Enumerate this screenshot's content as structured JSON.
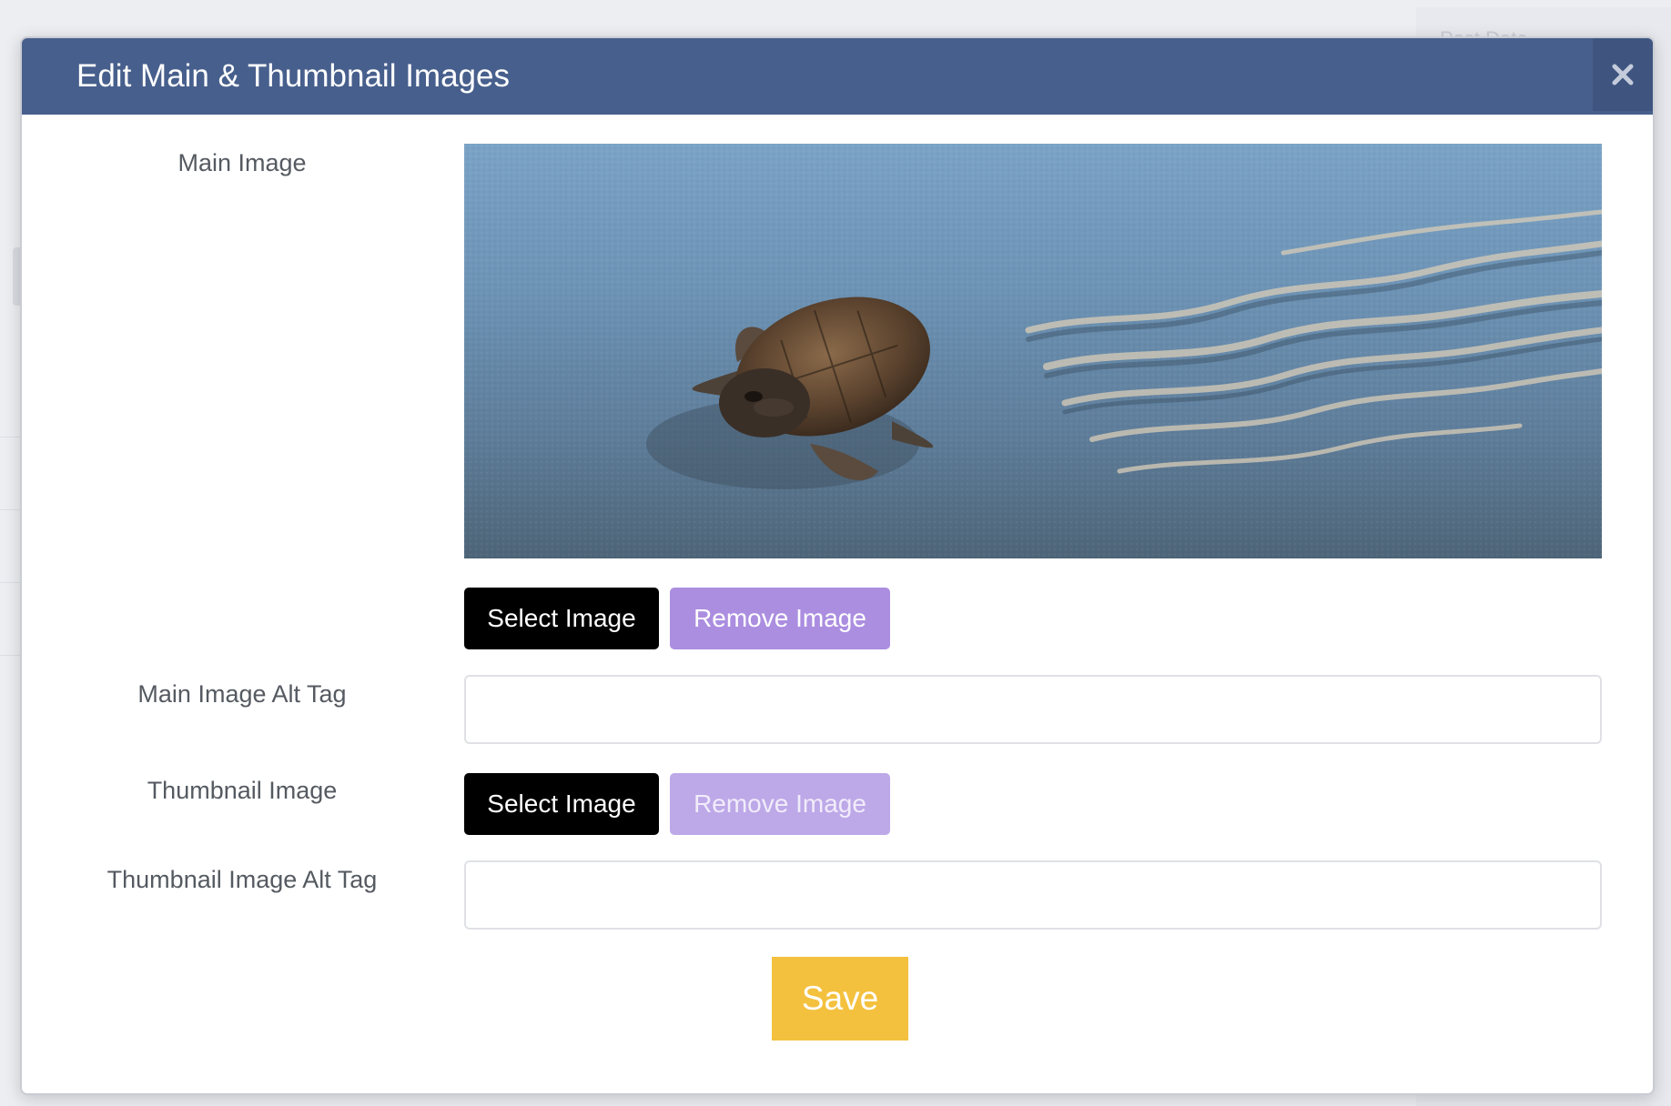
{
  "background": {
    "peek_text": "Post Date"
  },
  "modal": {
    "title": "Edit Main & Thumbnail Images",
    "close_icon": "close-x-icon",
    "header_color": "#475f8c"
  },
  "main_image": {
    "label": "Main Image",
    "image_subject": "baby sea turtle on sand",
    "select_label": "Select Image",
    "remove_label": "Remove Image"
  },
  "main_image_alt": {
    "label": "Main Image Alt Tag",
    "value": ""
  },
  "thumbnail_image": {
    "label": "Thumbnail Image",
    "select_label": "Select Image",
    "remove_label": "Remove Image"
  },
  "thumbnail_image_alt": {
    "label": "Thumbnail Image Alt Tag",
    "value": ""
  },
  "actions": {
    "save_label": "Save",
    "save_color": "#f4c13e",
    "select_color": "#000000",
    "remove_color": "#ab8ee0"
  }
}
